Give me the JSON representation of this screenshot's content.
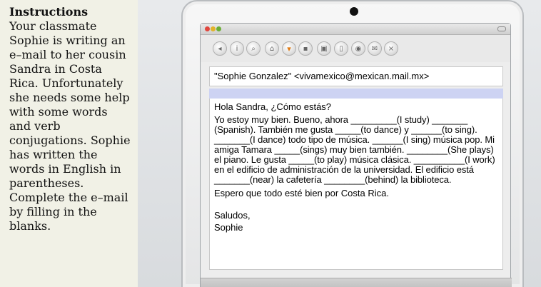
{
  "instructions": {
    "title": "Instructions",
    "body": "Your classmate Sophie is writing an e–mail to her cousin Sandra in Costa Rica. Unfortunately she needs some help with some words and verb conjugations. Sophie has written the words in English in parentheses. Complete the e–mail by filling in the blanks."
  },
  "email": {
    "from": "\"Sophie Gonzalez\" <vivamexico@mexican.mail.mx>",
    "greeting": "Hola Sandra, ¿Cómo estás?",
    "paragraph": "Yo estoy muy bien. Bueno, ahora _________(I study) _______ (Spanish). También me gusta _____(to dance) y ______(to sing). _______(I dance) todo tipo de música. ______(I sing) música pop. Mi amiga Tamara _____(sings) muy bien también. ________(She plays) el piano. Le gusta _____(to play) música clásica. __________(I work) en el edificio de administración de la universidad. El edificio está _______(near) la cafetería ________(behind) la biblioteca.",
    "closing": "Espero que todo esté bien por Costa Rica.",
    "signoff": "Saludos,",
    "signature": "Sophie"
  },
  "toolbar": {
    "icons": [
      "back-icon",
      "info-icon",
      "search-icon",
      "home-icon",
      "download-icon",
      "save-icon",
      "image-icon",
      "document-icon",
      "settings-icon",
      "mail-icon",
      "close-icon"
    ],
    "glyphs": [
      "◂",
      "i",
      "⌕",
      "⌂",
      "▾",
      "▪",
      "▣",
      "▯",
      "◉",
      "✉",
      "×"
    ]
  },
  "colors": {
    "left_panel_bg": "#f1f1e6",
    "subject_highlight": "#cdd3f3",
    "download_accent": "#e07a12"
  }
}
